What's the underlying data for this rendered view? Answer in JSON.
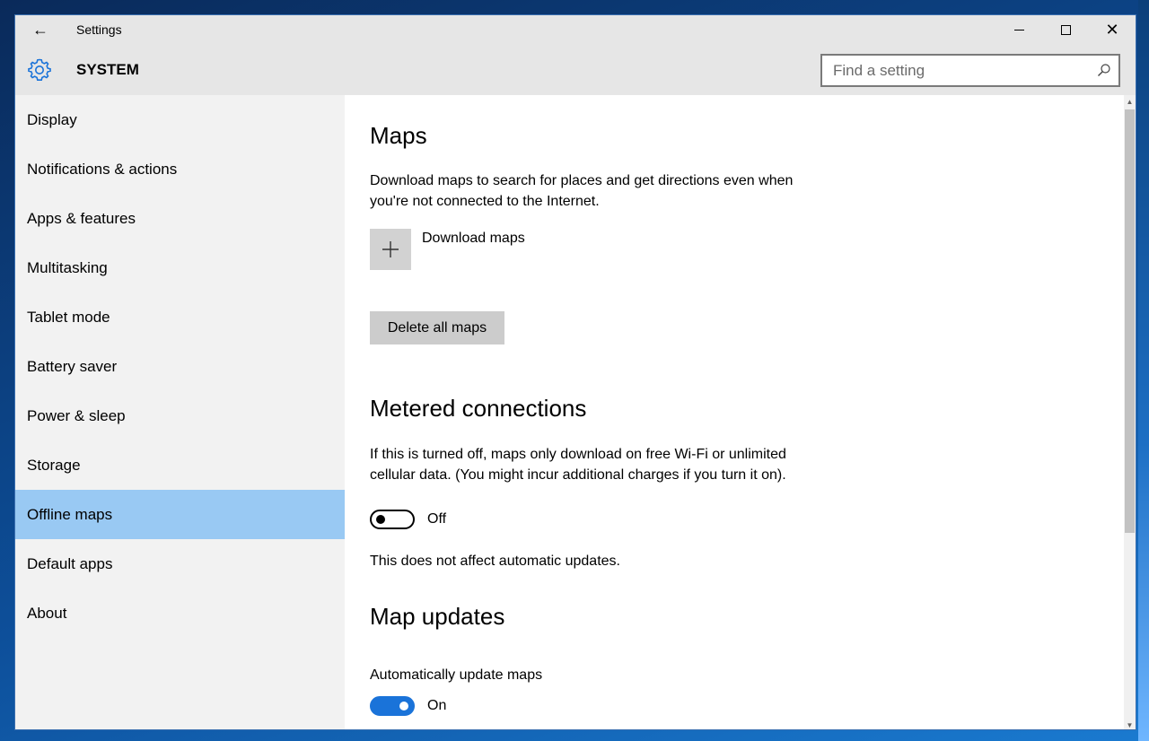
{
  "window": {
    "title": "Settings",
    "back_glyph": "←",
    "minimize": "minimize",
    "maximize": "maximize",
    "close_glyph": "✕"
  },
  "header": {
    "section": "SYSTEM",
    "icon": "gear-icon",
    "search_placeholder": "Find a setting"
  },
  "sidebar": {
    "items": [
      {
        "label": "Display"
      },
      {
        "label": "Notifications & actions"
      },
      {
        "label": "Apps & features"
      },
      {
        "label": "Multitasking"
      },
      {
        "label": "Tablet mode"
      },
      {
        "label": "Battery saver"
      },
      {
        "label": "Power & sleep"
      },
      {
        "label": "Storage"
      },
      {
        "label": "Offline maps",
        "selected": true
      },
      {
        "label": "Default apps"
      },
      {
        "label": "About"
      }
    ]
  },
  "maps": {
    "heading": "Maps",
    "description_line1": "Download maps to search for places and get directions even when",
    "description_line2": "you're not connected to the Internet.",
    "download_label": "Download maps",
    "delete_label": "Delete all maps"
  },
  "metered": {
    "heading": "Metered connections",
    "description_line1": "If this is turned off, maps only download on free Wi-Fi or unlimited",
    "description_line2": "cellular data. (You might incur additional charges if you turn it on).",
    "toggle_state": "Off",
    "note": "This does not affect automatic updates."
  },
  "updates": {
    "heading": "Map updates",
    "auto_label": "Automatically update maps",
    "toggle_state": "On"
  },
  "colors": {
    "selected_nav": "#99c9f3",
    "toggle_on": "#1a73d9",
    "chrome": "#e6e6e6",
    "sidebar": "#f2f2f2"
  }
}
